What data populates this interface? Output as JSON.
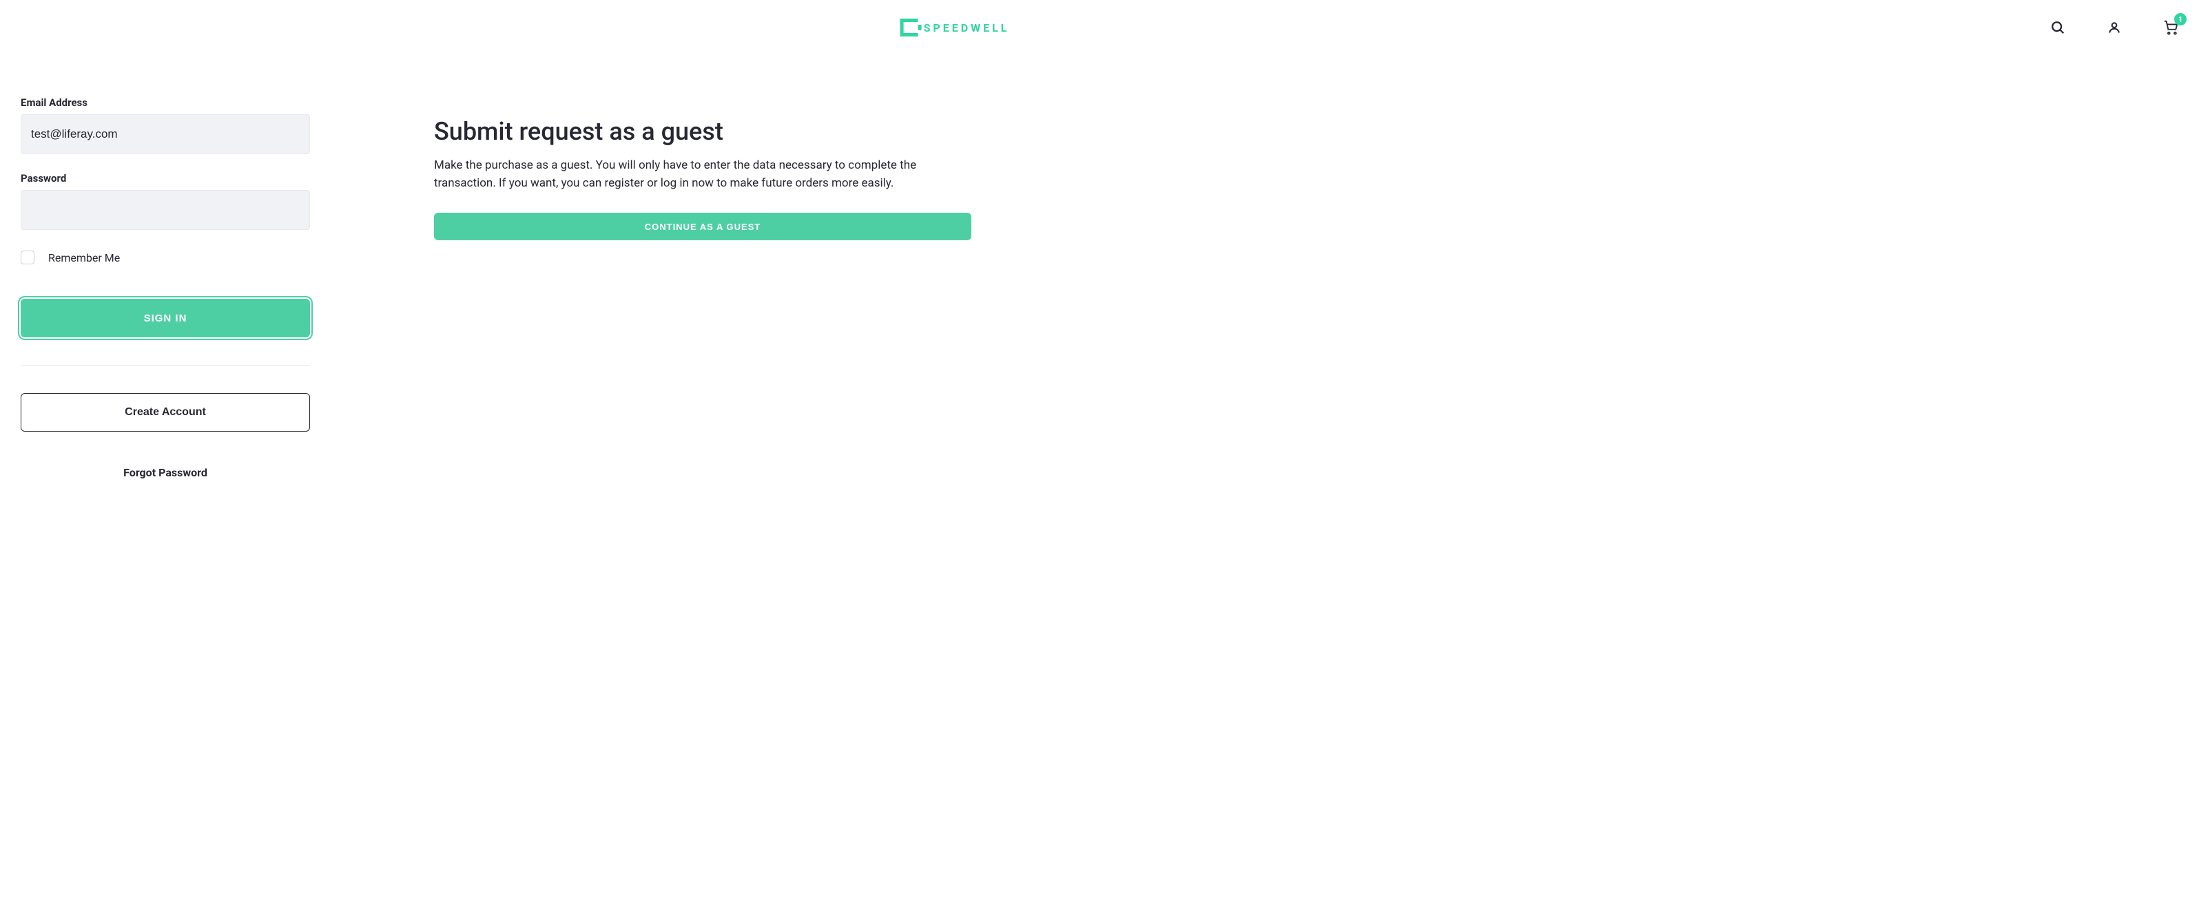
{
  "header": {
    "brand_name": "SPEEDWELL",
    "cart_count": "1"
  },
  "login": {
    "email_label": "Email Address",
    "email_value": "test@liferay.com",
    "password_label": "Password",
    "password_value": "",
    "remember_label": "Remember Me",
    "signin_button": "Sign In",
    "create_account_button": "Create Account",
    "forgot_password": "Forgot Password"
  },
  "guest": {
    "title": "Submit request as a guest",
    "description": "Make the purchase as a guest. You will only have to enter the data necessary to complete the transaction. If you want, you can register or log in now to make future orders more easily.",
    "continue_button": "Continue as a Guest"
  }
}
